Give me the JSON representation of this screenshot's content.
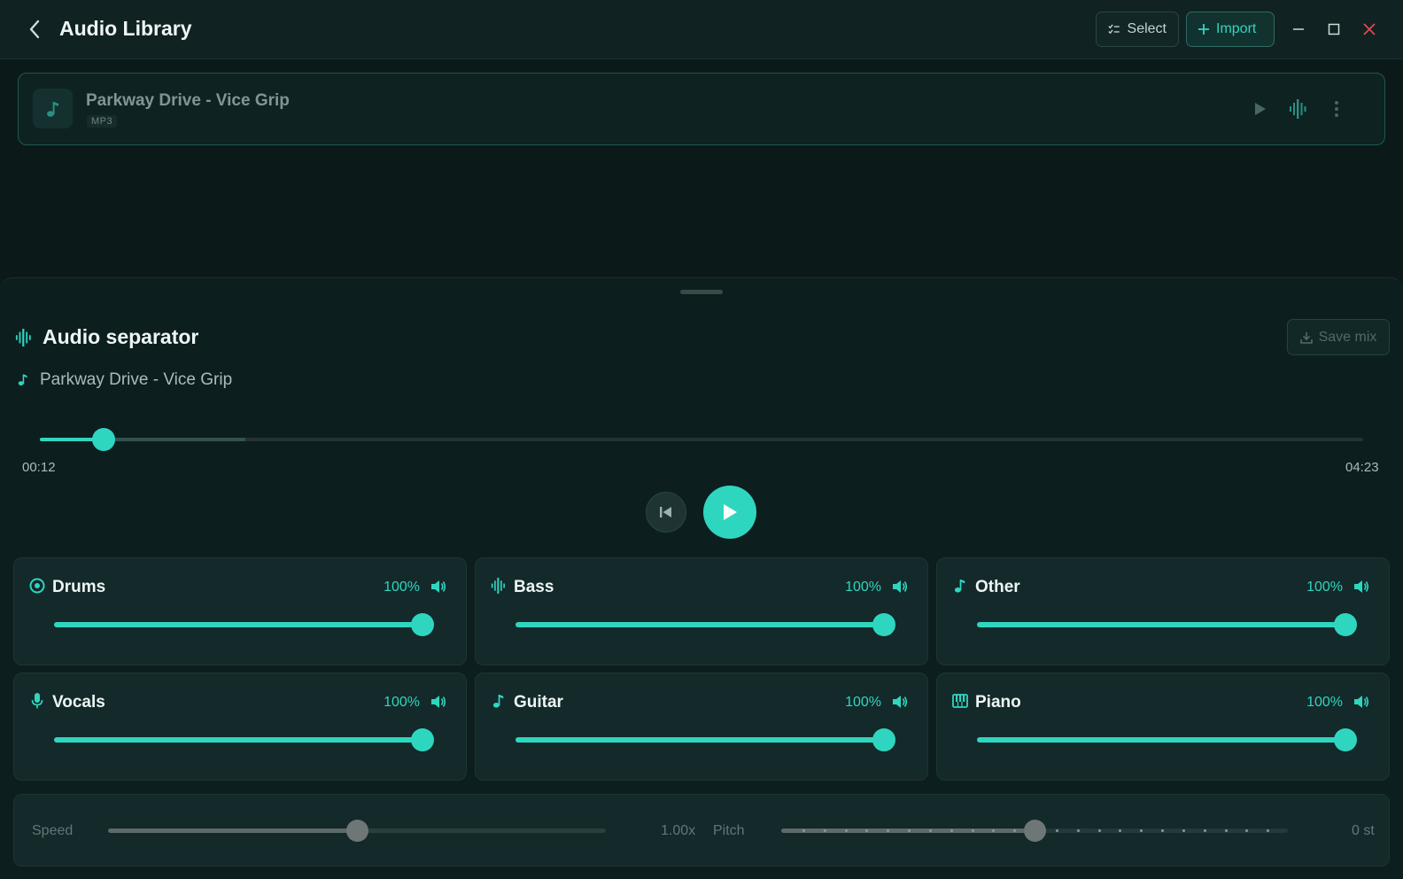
{
  "header": {
    "title": "Audio Library",
    "select_label": "Select",
    "import_label": "Import"
  },
  "track": {
    "name": "Parkway Drive - Vice Grip",
    "format": "MP3"
  },
  "separator": {
    "title": "Audio separator",
    "save_label": "Save mix",
    "song": "Parkway Drive - Vice Grip",
    "current_time": "00:12",
    "total_time": "04:23",
    "progress_fraction": 0.048,
    "buffered_fraction": 0.155
  },
  "stems": [
    {
      "name": "Drums",
      "percent": "100%",
      "icon": "disc-icon",
      "level": 1.0
    },
    {
      "name": "Bass",
      "percent": "100%",
      "icon": "waveform-icon",
      "level": 1.0
    },
    {
      "name": "Other",
      "percent": "100%",
      "icon": "music-note-icon",
      "level": 1.0
    },
    {
      "name": "Vocals",
      "percent": "100%",
      "icon": "microphone-icon",
      "level": 1.0
    },
    {
      "name": "Guitar",
      "percent": "100%",
      "icon": "music-note-icon",
      "level": 1.0
    },
    {
      "name": "Piano",
      "percent": "100%",
      "icon": "piano-icon",
      "level": 1.0
    }
  ],
  "controls": {
    "speed_label": "Speed",
    "speed_value": "1.00x",
    "speed_fraction": 0.5,
    "pitch_label": "Pitch",
    "pitch_value": "0 st",
    "pitch_fraction": 0.5
  },
  "colors": {
    "accent": "#2fd6bf",
    "background": "#0b1919",
    "close": "#e5484d"
  }
}
